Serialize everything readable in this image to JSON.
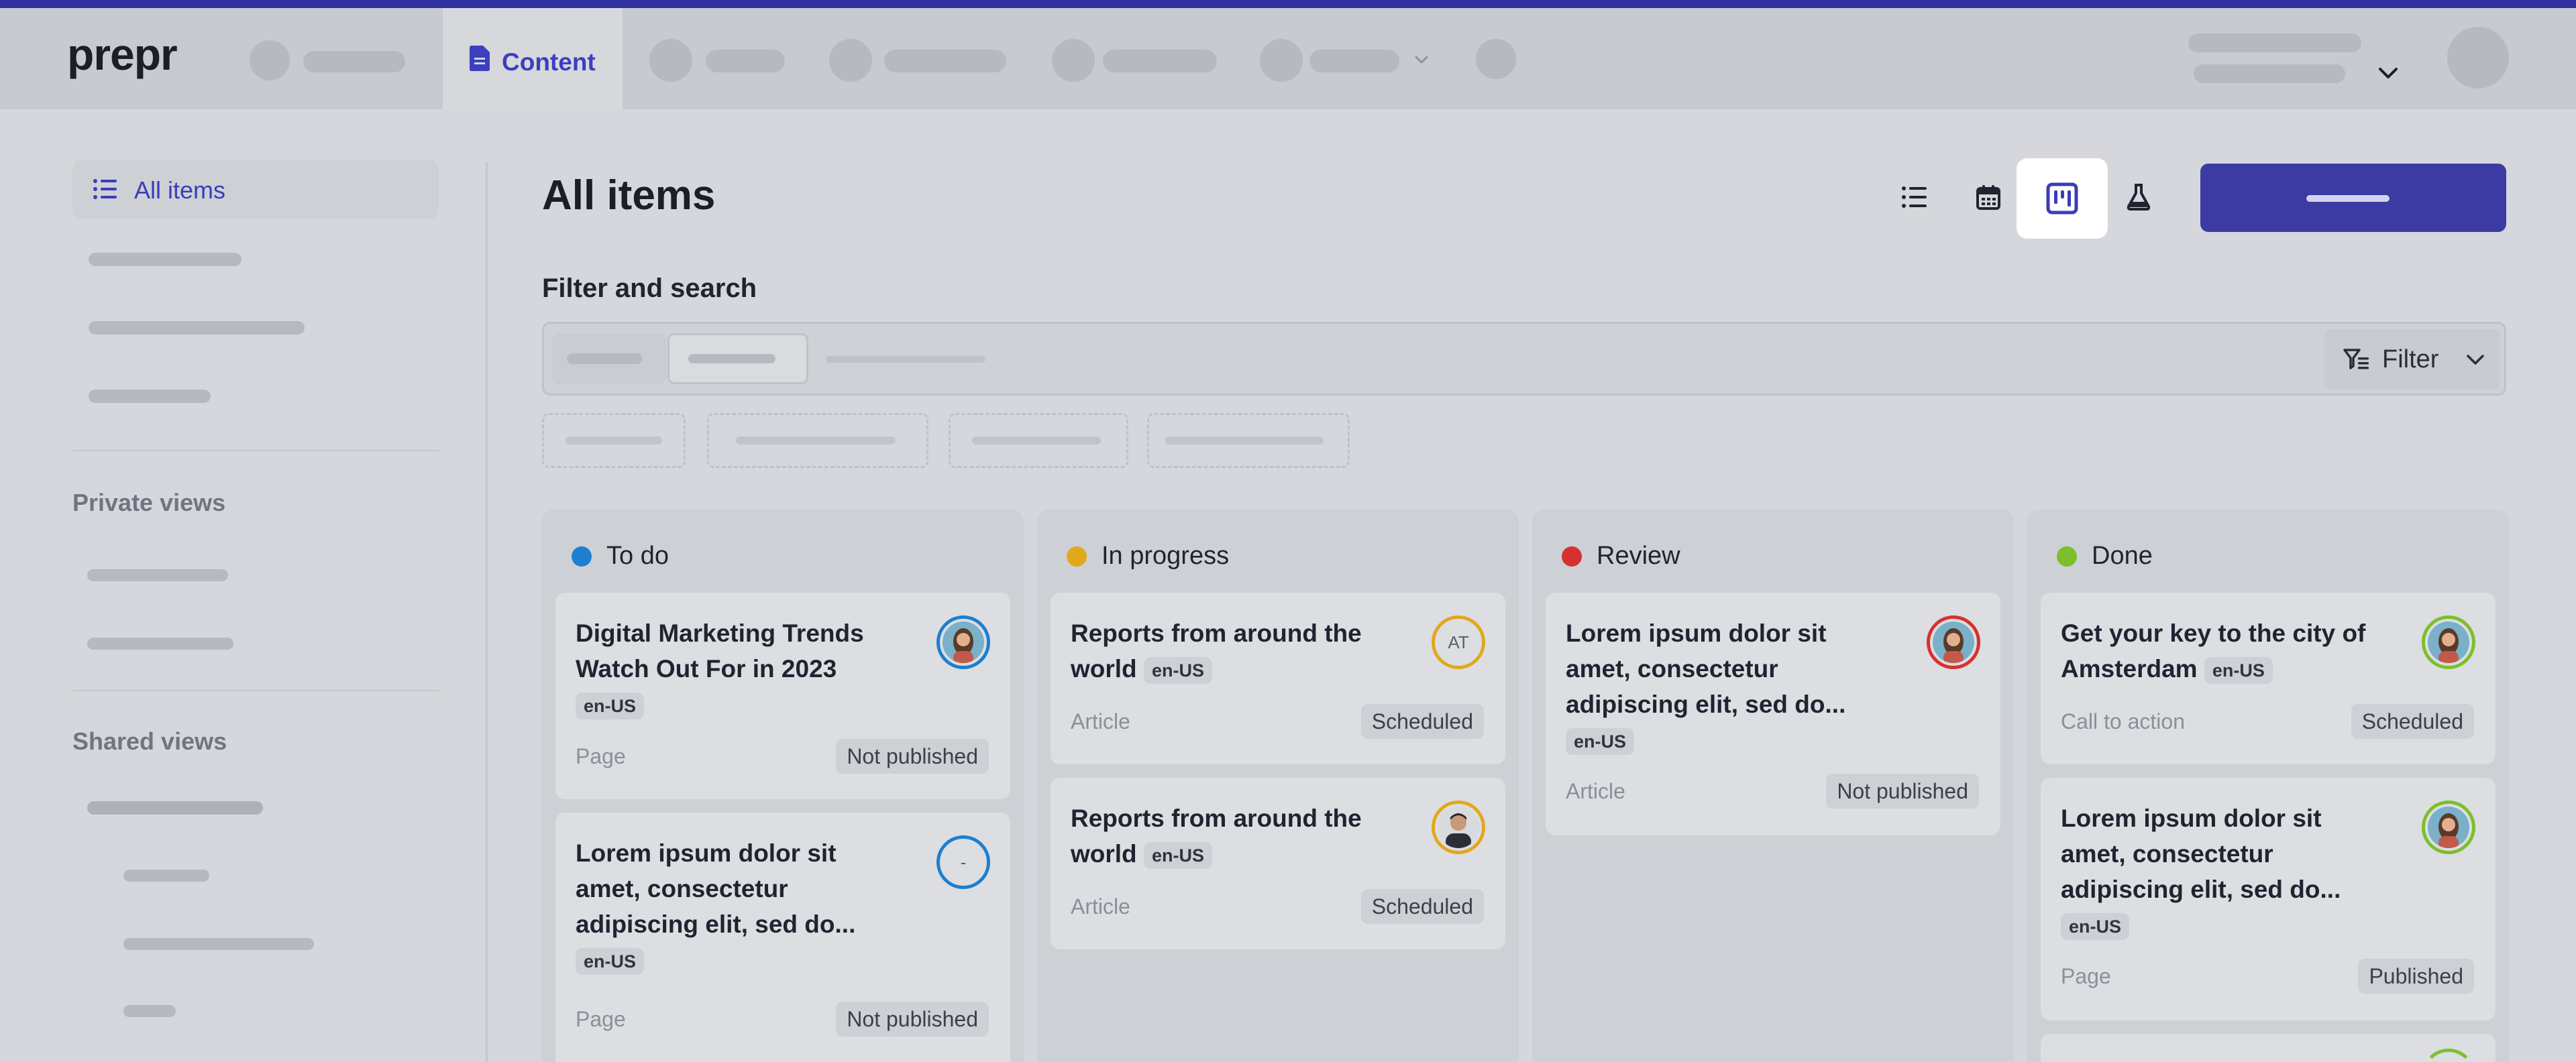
{
  "app": {
    "logo": "prepr"
  },
  "nav": {
    "active_tab": "Content"
  },
  "sidebar": {
    "active_item": "All items",
    "private_views_heading": "Private views",
    "shared_views_heading": "Shared views"
  },
  "main": {
    "title": "All items",
    "filter_heading": "Filter and search",
    "filter_button": "Filter"
  },
  "colors": {
    "accent": "#3b3ba3",
    "todo": "#1d7fcf",
    "in_progress": "#e2a81c",
    "review": "#d63131",
    "done": "#7cbf2a"
  },
  "board": {
    "columns": [
      {
        "title": "To do",
        "cards": [
          {
            "title": "Digital Marketing Trends Watch Out For in 2023",
            "locale": "en-US",
            "type": "Page",
            "status": "Not published",
            "avatar": ""
          },
          {
            "title": "Lorem ipsum dolor sit amet, consectetur adipiscing elit, sed do...",
            "locale": "en-US",
            "type": "Page",
            "status": "Not published",
            "avatar": "-"
          }
        ]
      },
      {
        "title": "In progress",
        "cards": [
          {
            "title": "Reports from around the world",
            "locale": "en-US",
            "type": "Article",
            "status": "Scheduled",
            "avatar": "AT"
          },
          {
            "title": "Reports from around the world",
            "locale": "en-US",
            "type": "Article",
            "status": "Scheduled",
            "avatar": ""
          }
        ]
      },
      {
        "title": "Review",
        "cards": [
          {
            "title": "Lorem ipsum dolor sit amet, consectetur adipiscing elit, sed do...",
            "locale": "en-US",
            "type": "Article",
            "status": "Not published",
            "avatar": ""
          }
        ]
      },
      {
        "title": "Done",
        "cards": [
          {
            "title": "Get your key to the city of Amsterdam",
            "locale": "en-US",
            "type": "Call to action",
            "status": "Scheduled",
            "avatar": ""
          },
          {
            "title": "Lorem ipsum dolor sit amet, consectetur adipiscing elit, sed do...",
            "locale": "en-US",
            "type": "Page",
            "status": "Published",
            "avatar": ""
          }
        ]
      }
    ]
  }
}
